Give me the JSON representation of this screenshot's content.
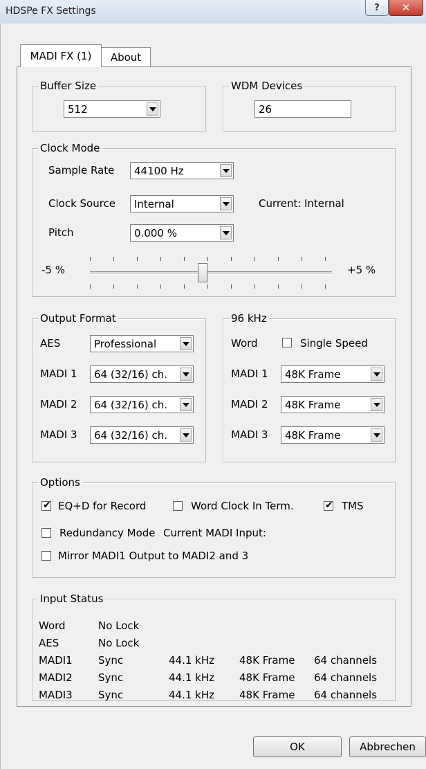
{
  "window": {
    "title": "HDSPe FX Settings"
  },
  "tabs": [
    {
      "label": "MADI FX (1)"
    },
    {
      "label": "About"
    }
  ],
  "buffer_size": {
    "legend": "Buffer Size",
    "value": "512"
  },
  "wdm_devices": {
    "legend": "WDM Devices",
    "value": "26"
  },
  "clock_mode": {
    "legend": "Clock Mode",
    "sample_rate_label": "Sample Rate",
    "sample_rate_value": "44100 Hz",
    "clock_source_label": "Clock Source",
    "clock_source_value": "Internal",
    "current_label": "Current:",
    "current_value": "Internal",
    "pitch_label": "Pitch",
    "pitch_value": "0.000 %",
    "slider_min": "-5 %",
    "slider_max": "+5 %",
    "slider_fraction": 0.5
  },
  "output_format": {
    "legend": "Output Format",
    "aes_label": "AES",
    "aes_value": "Professional",
    "rows": [
      {
        "label": "MADI 1",
        "value": "64 (32/16) ch."
      },
      {
        "label": "MADI 2",
        "value": "64 (32/16) ch."
      },
      {
        "label": "MADI 3",
        "value": "64 (32/16) ch."
      }
    ]
  },
  "khz96": {
    "legend": "96 kHz",
    "word_label": "Word",
    "single_speed_label": "Single Speed",
    "single_speed_checked": false,
    "rows": [
      {
        "label": "MADI 1",
        "value": "48K Frame"
      },
      {
        "label": "MADI 2",
        "value": "48K Frame"
      },
      {
        "label": "MADI 3",
        "value": "48K Frame"
      }
    ]
  },
  "options": {
    "legend": "Options",
    "eqd_label": "EQ+D for Record",
    "eqd_checked": true,
    "word_clock_label": "Word Clock In Term.",
    "word_clock_checked": false,
    "tms_label": "TMS",
    "tms_checked": true,
    "redundancy_label": "Redundancy Mode",
    "redundancy_checked": false,
    "current_madi_label": "Current MADI Input:",
    "mirror_label": "Mirror MADI1 Output to MADI2 and 3",
    "mirror_checked": false
  },
  "input_status": {
    "legend": "Input Status",
    "rows": [
      [
        "Word",
        "No Lock",
        "",
        "",
        ""
      ],
      [
        "AES",
        "No Lock",
        "",
        "",
        ""
      ],
      [
        "MADI1",
        "Sync",
        "44.1 kHz",
        "48K Frame",
        "64 channels"
      ],
      [
        "MADI2",
        "Sync",
        "44.1 kHz",
        "48K Frame",
        "64 channels"
      ],
      [
        "MADI3",
        "Sync",
        "44.1 kHz",
        "48K Frame",
        "64 channels"
      ]
    ]
  },
  "buttons": {
    "ok": "OK",
    "cancel": "Abbrechen"
  },
  "checkmark_glyph": "✔",
  "icons": {
    "help": "question-icon",
    "close": "close-icon"
  }
}
